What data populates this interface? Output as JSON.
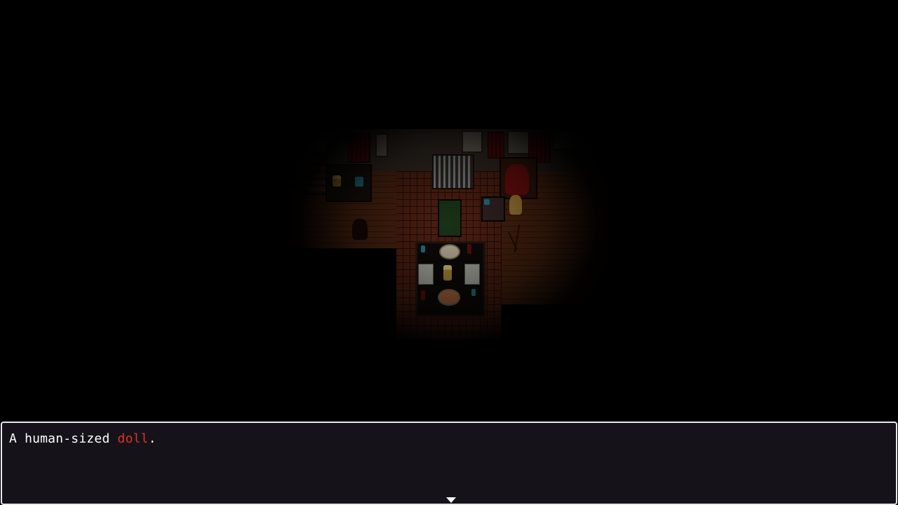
{
  "message": {
    "prefix": "A human-sized ",
    "highlight": "doll",
    "suffix": ".",
    "highlight_color": "#e0302a",
    "text_color": "#ffffff"
  },
  "continue_indicator": "down-triangle-icon",
  "scene": {
    "lighting": "dark, single lit area",
    "room": "dining room"
  }
}
